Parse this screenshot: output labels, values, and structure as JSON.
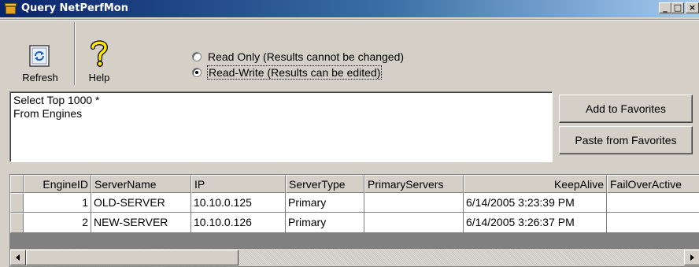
{
  "window": {
    "title": "Query NetPerfMon"
  },
  "toolbar": {
    "refresh_label": "Refresh",
    "help_label": "Help"
  },
  "mode": {
    "options": [
      {
        "label": "Read Only (Results cannot be changed)",
        "checked": false
      },
      {
        "label": "Read-Write (Results can be edited)",
        "checked": true
      }
    ]
  },
  "query": {
    "text": "Select Top 1000 *\nFrom Engines"
  },
  "favorites": {
    "add_label": "Add to Favorites",
    "paste_label": "Paste from Favorites"
  },
  "grid": {
    "columns": [
      "EngineID",
      "ServerName",
      "IP",
      "ServerType",
      "PrimaryServers",
      "KeepAlive",
      "FailOverActive"
    ],
    "rows": [
      [
        "1",
        "OLD-SERVER",
        "10.10.0.125",
        "Primary",
        "",
        "6/14/2005 3:23:39 PM",
        ""
      ],
      [
        "2",
        "NEW-SERVER",
        "10.10.0.126",
        "Primary",
        "",
        "6/14/2005 3:26:37 PM",
        ""
      ]
    ]
  }
}
